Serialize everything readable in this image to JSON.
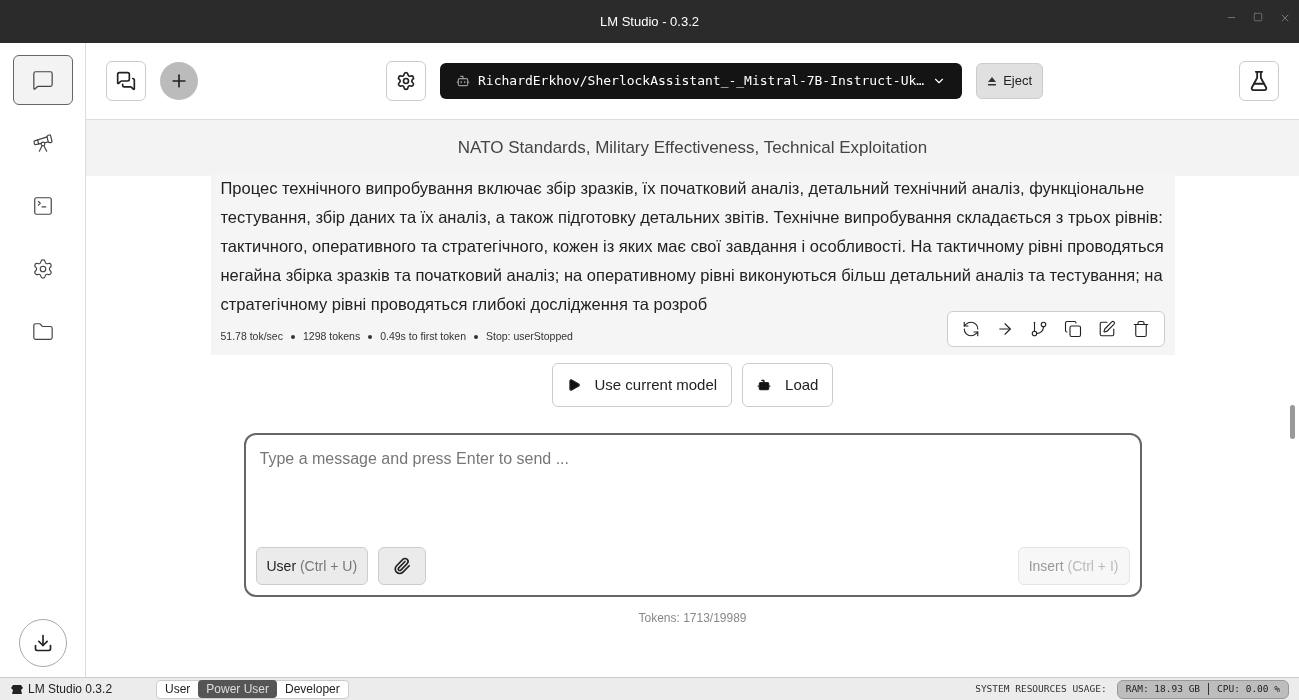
{
  "window": {
    "title": "LM Studio - 0.3.2"
  },
  "sidebar": {
    "items": [
      {
        "selected": true
      },
      {
        "selected": false
      },
      {
        "selected": false
      },
      {
        "selected": false
      },
      {
        "selected": false
      }
    ]
  },
  "toolbar": {
    "model": "RichardErkhov/SherlockAssistant_-_Mistral-7B-Instruct-Uk…",
    "eject": "Eject"
  },
  "chat": {
    "title": "NATO Standards, Military Effectiveness, Technical Exploitation",
    "message": "Процес технічного випробування включає збір зразків, їх початковий аналіз, детальний технічний аналіз, функціональне тестування, збір даних та їх аналіз, а також підготовку детальних звітів. Технічне випробування складається з трьох рівнів: тактичного, оперативного та стратегічного, кожен із яких має свої завдання і особливості. На тактичному рівні проводяться негайна збірка зразків та початковий аналіз; на оперативному рівні виконуються більш детальний аналіз та тестування; на стратегічному рівні проводяться глибокі дослідження та розроб",
    "stats": [
      "51.78 tok/sec",
      "1298 tokens",
      "0.49s to first token",
      "Stop: userStopped"
    ],
    "model_buttons": [
      {
        "kind": "play",
        "label": "Use current model"
      },
      {
        "kind": "load",
        "label": "Load"
      }
    ]
  },
  "composer": {
    "placeholder": "Type a message and press Enter to send ...",
    "role": {
      "label": "User",
      "shortcut": "(Ctrl + U)"
    },
    "insert": {
      "label": "Insert",
      "shortcut": "(Ctrl + I)",
      "disabled": true
    },
    "tokens": "Tokens: 1713/19989"
  },
  "status_bar": {
    "app": "LM Studio 0.3.2",
    "modes": [
      {
        "label": "User",
        "selected": false
      },
      {
        "label": "Power User",
        "selected": true
      },
      {
        "label": "Developer",
        "selected": false
      }
    ],
    "resources_label": "SYSTEM RESOURCES USAGE:",
    "ram": "RAM: 18.93 GB",
    "cpu": "CPU: 0.00 %"
  }
}
